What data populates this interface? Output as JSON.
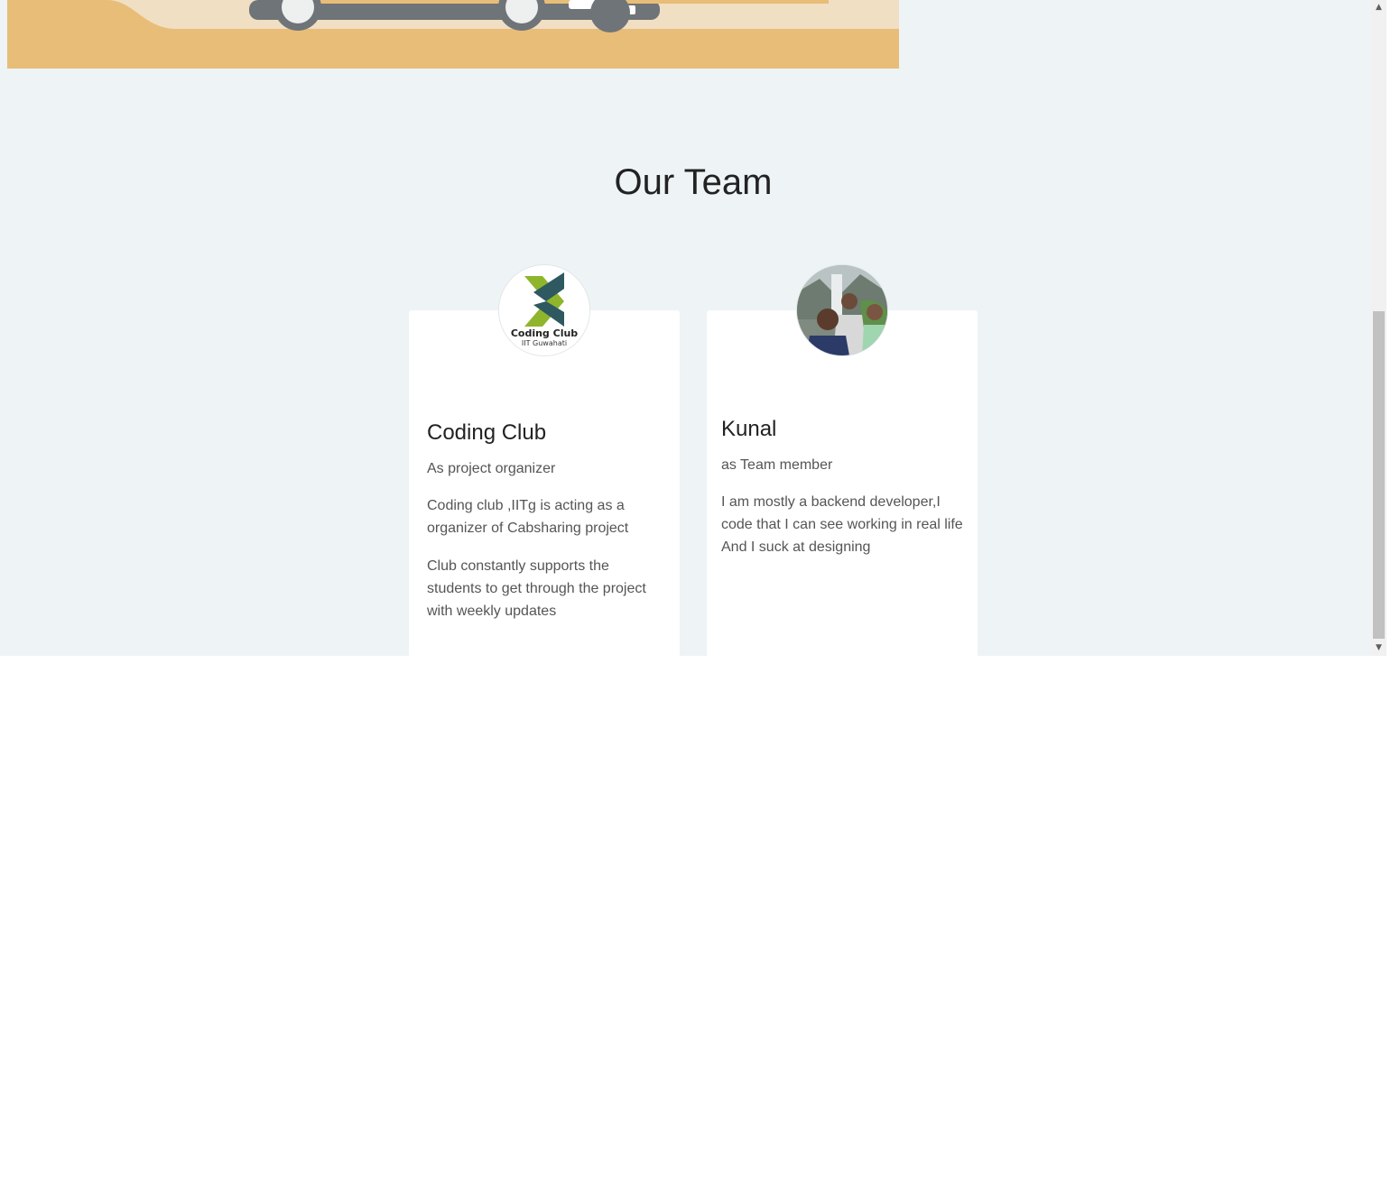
{
  "colors": {
    "page_background": "#eef3f6",
    "card_background": "#ffffff",
    "hero_sand": "#e8bd78",
    "hero_cream": "#f0dfc3",
    "car_body": "#6f7478"
  },
  "hero": {
    "illustration": "car-illustration"
  },
  "team_section": {
    "title": "Our Team",
    "members": [
      {
        "avatar": "coding-club-logo",
        "logo_text_main": "Coding Club",
        "logo_text_sub": "IIT Guwahati",
        "name": "Coding Club",
        "role": "As project organizer",
        "paragraphs": [
          "Coding club ,IITg is acting as a organizer of Cabsharing project",
          "Club constantly supports the students to get through the project with weekly updates"
        ]
      },
      {
        "avatar": "group-photo",
        "name": "Kunal",
        "role": "as Team member",
        "paragraphs": [
          "I am mostly a backend developer,I code that I can see working in real life And I suck at designing"
        ]
      }
    ]
  },
  "scrollbar": {
    "up_icon": "chevron-up-icon",
    "down_icon": "chevron-down-icon",
    "up_glyph": "▲",
    "down_glyph": "▼"
  }
}
